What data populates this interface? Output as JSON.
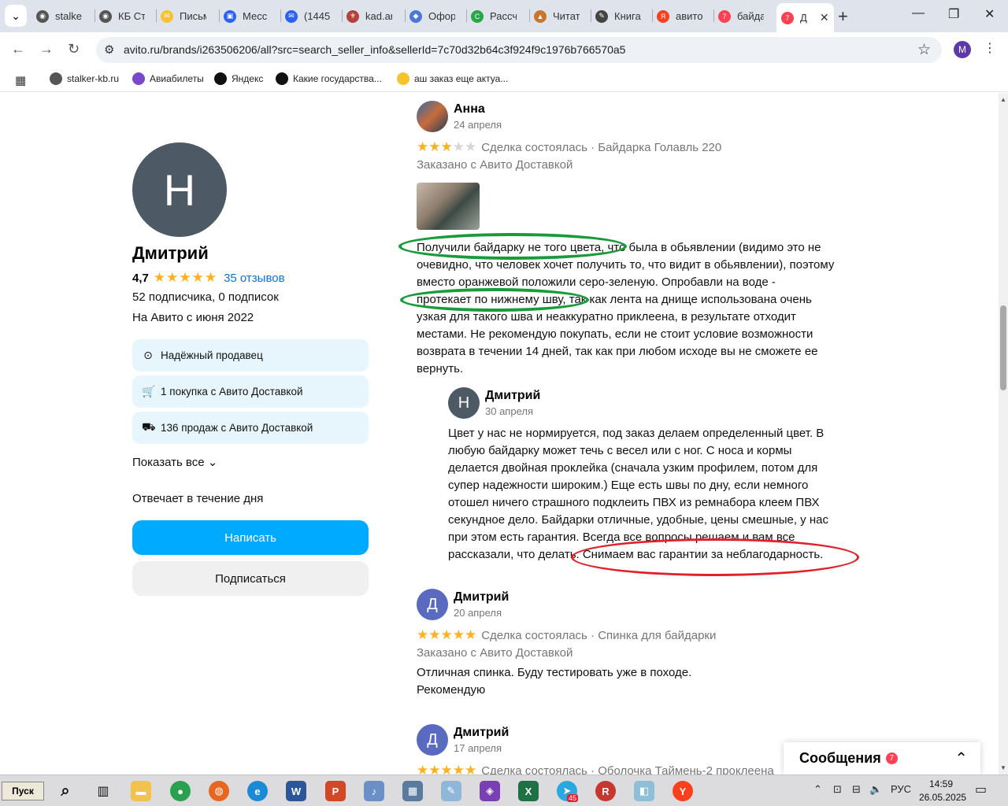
{
  "browser": {
    "tabs": [
      {
        "title": "stalke",
        "color": "#555555",
        "glyph": "◉"
      },
      {
        "title": "КБ Ст",
        "color": "#555555",
        "glyph": "◉"
      },
      {
        "title": "Письм",
        "color": "#f6c32d",
        "glyph": "✉"
      },
      {
        "title": "Месс",
        "color": "#2b62f2",
        "glyph": "▣"
      },
      {
        "title": "(1445",
        "color": "#2b62f2",
        "glyph": "✉"
      },
      {
        "title": "kad.ar",
        "color": "#b2433a",
        "glyph": "⚜"
      },
      {
        "title": "Офор",
        "color": "#4a78d8",
        "glyph": "◆"
      },
      {
        "title": "Рассч",
        "color": "#28a745",
        "glyph": "C"
      },
      {
        "title": "Читат",
        "color": "#c8762c",
        "glyph": "▲"
      },
      {
        "title": "Книга",
        "color": "#444444",
        "glyph": "✎"
      },
      {
        "title": "авито",
        "color": "#fc3f1d",
        "glyph": "Я"
      },
      {
        "title": "байда",
        "color": "#ff4053",
        "glyph": "7"
      }
    ],
    "active_tab": {
      "title": "Д",
      "badge": "7",
      "close": "✕"
    },
    "url": "avito.ru/brands/i263506206/all?src=search_seller_info&sellerId=7c70d32b64c3f924f9c1976b766570a5",
    "profile_initial": "M",
    "bookmarks": [
      {
        "label": "stalker-kb.ru",
        "color": "#555555"
      },
      {
        "label": "Авиабилеты",
        "color": "#7a48c9"
      },
      {
        "label": "Яндекс",
        "color": "#111111"
      },
      {
        "label": "Какие государства...",
        "color": "#111111"
      },
      {
        "label": "аш заказ еще актуа...",
        "color": "#f6c32d"
      }
    ]
  },
  "seller": {
    "initial": "Н",
    "name": "Дмитрий",
    "rating": "4,7",
    "stars": "★★★★★",
    "reviews_link": "35 отзывов",
    "followers": "52 подписчика, 0 подписок",
    "since": "На Авито с июня 2022",
    "badges": [
      {
        "icon": "check-circle-icon",
        "glyph": "⊙",
        "label": "Надёжный продавец"
      },
      {
        "icon": "cart-icon",
        "glyph": "🛒",
        "label": "1 покупка с Авито Доставкой"
      },
      {
        "icon": "truck-icon",
        "glyph": "⛟",
        "label": "136 продаж с Авито Доставкой"
      }
    ],
    "show_all": "Показать все ⌄",
    "reply_time": "Отвечает в течение дня",
    "write_button": "Написать",
    "subscribe_button": "Подписаться"
  },
  "reviews": [
    {
      "author": "Анна",
      "date": "24 апреля",
      "rating": 3,
      "meta": "Сделка состоялась · Байдарка Голавль 220",
      "delivery": "Заказано с Авито Доставкой",
      "lines": [
        "Получили байдарку не того цвета, что была в обьявлении (видимо это не",
        "очевидно, что человек хочет получить то, что видит в обьявлении), поэтому",
        "вместо оранжевой положили серо-зеленую. Опробавли на воде -",
        "протекает по нижнему шву, так как лента на днище использована очень",
        "узкая для такого шва и неаккуратно приклеена, в результате отходит",
        "местами. Не рекомендую покупать, если не стоит условие возможности",
        "возврата в течении 14 дней, так как при любом исходе вы не сможете ее",
        "вернуть."
      ],
      "reply": {
        "initial": "Н",
        "author": "Дмитрий",
        "date": "30 апреля",
        "lines": [
          "Цвет у нас не нормируется, под заказ делаем определенный цвет. В",
          "любую байдарку может течь с весел или с ног. С носа и кормы",
          "делается двойная проклейка (сначала узким профилем, потом для",
          "супер надежности широким.) Еще есть швы по дну, если немного",
          "отошел ничего страшного подклеить ПВХ из ремнабора клеем ПВХ",
          "секундное дело. Байдарки отличные, удобные, цены смешные, у нас",
          "при этом есть гарантия. Всегда все вопросы решаем и вам все",
          "рассказали, что делать. Снимаем вас гарантии за неблагодарность."
        ]
      }
    },
    {
      "initial": "Д",
      "author": "Дмитрий",
      "date": "20 апреля",
      "rating": 5,
      "meta": "Сделка состоялась · Спинка для байдарки",
      "delivery": "Заказано с Авито Доставкой",
      "lines": [
        "Отличная спинка. Буду тестировать уже в походе.",
        "Рекомендую"
      ]
    },
    {
      "initial": "Д",
      "author": "Дмитрий",
      "date": "17 апреля",
      "rating": 5,
      "meta": "Сделка состоялась · Оболочка Таймень-2 проклеена"
    }
  ],
  "annotations": {
    "green": "#1a9b3a",
    "red": "#e0202a"
  },
  "messages": {
    "title": "Сообщения",
    "count": "7"
  },
  "taskbar": {
    "start": "Пуск",
    "telegram_badge": "45",
    "lang": "РУС",
    "time": "14:59",
    "date": "26.05.2025"
  }
}
